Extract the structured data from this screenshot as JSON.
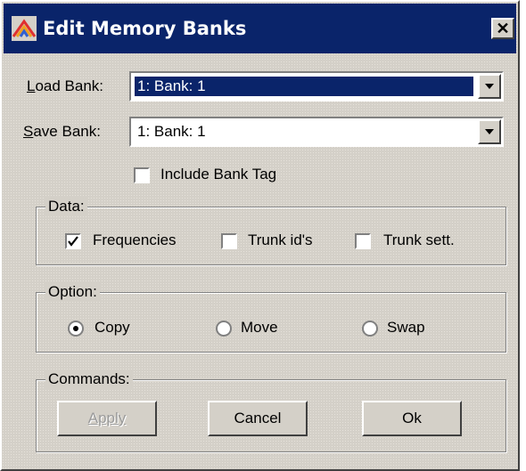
{
  "window": {
    "title": "Edit Memory Banks",
    "icon": "app-icon"
  },
  "load_bank": {
    "label_prefix": "L",
    "label_rest": "oad Bank:",
    "value": "1: Bank: 1"
  },
  "save_bank": {
    "label_prefix": "S",
    "label_rest": "ave Bank:",
    "value": "1: Bank: 1"
  },
  "include_bank_tag": {
    "label": "Include Bank Tag",
    "checked": false
  },
  "data_group": {
    "title": "Data:",
    "options": [
      {
        "label": "Frequencies",
        "checked": true
      },
      {
        "label": "Trunk id's",
        "checked": false
      },
      {
        "label": "Trunk sett.",
        "checked": false
      }
    ]
  },
  "option_group": {
    "title": "Option:",
    "options": [
      {
        "label": "Copy",
        "selected": true
      },
      {
        "label": "Move",
        "selected": false
      },
      {
        "label": "Swap",
        "selected": false
      }
    ]
  },
  "commands_group": {
    "title": "Commands:",
    "apply_label": "Apply",
    "cancel_label": "Cancel",
    "ok_label": "Ok"
  },
  "colors": {
    "titlebar": "#0a246a",
    "face": "#d4d0c8",
    "selection": "#0a246a"
  }
}
